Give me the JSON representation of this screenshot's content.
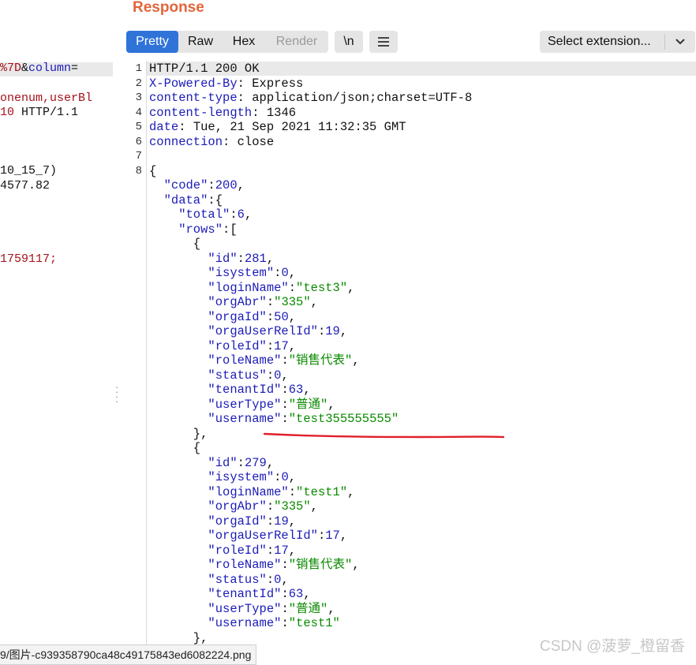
{
  "left_pane": {
    "lines": [
      {
        "parts": [
          {
            "t": "%7D",
            "c": "red"
          },
          {
            "t": "&",
            "c": "plain"
          },
          {
            "t": "column",
            "c": "key"
          },
          {
            "t": "=",
            "c": "plain"
          }
        ]
      },
      {
        "parts": [
          {
            "t": "onenum,userBl",
            "c": "red"
          }
        ]
      },
      {
        "parts": [
          {
            "t": "10",
            "c": "red"
          },
          {
            "t": " HTTP/1.1",
            "c": "plain"
          }
        ]
      },
      {
        "parts": [
          {
            "t": "10_15_7)",
            "c": "plain"
          }
        ]
      },
      {
        "parts": [
          {
            "t": "4577.82",
            "c": "plain"
          }
        ]
      },
      {
        "parts": [
          {
            "t": "1759117;",
            "c": "red"
          }
        ]
      }
    ]
  },
  "response": {
    "title": "Response",
    "tabs": [
      {
        "label": "Pretty",
        "state": "active"
      },
      {
        "label": "Raw",
        "state": "normal"
      },
      {
        "label": "Hex",
        "state": "normal"
      },
      {
        "label": "Render",
        "state": "disabled"
      }
    ],
    "newline_button": "\\n",
    "menu_icon": "hamburger-menu-icon",
    "extension_select": "Select extension...",
    "line_numbers": [
      "1",
      "2",
      "3",
      "4",
      "5",
      "6",
      "7",
      "8"
    ],
    "lines": [
      {
        "parts": [
          {
            "t": "HTTP/1.1 200 OK",
            "c": "p"
          }
        ]
      },
      {
        "parts": [
          {
            "t": "X-Powered-By",
            "c": "k"
          },
          {
            "t": ": Express",
            "c": "p"
          }
        ]
      },
      {
        "parts": [
          {
            "t": "content-type",
            "c": "k"
          },
          {
            "t": ": application/json;charset=UTF-8",
            "c": "p"
          }
        ]
      },
      {
        "parts": [
          {
            "t": "content-length",
            "c": "k"
          },
          {
            "t": ": 1346",
            "c": "p"
          }
        ]
      },
      {
        "parts": [
          {
            "t": "date",
            "c": "k"
          },
          {
            "t": ": Tue, 21 Sep 2021 11:32:35 GMT",
            "c": "p"
          }
        ]
      },
      {
        "parts": [
          {
            "t": "connection",
            "c": "k"
          },
          {
            "t": ": close",
            "c": "p"
          }
        ]
      },
      {
        "parts": []
      },
      {
        "parts": [
          {
            "t": "{",
            "c": "p"
          }
        ]
      },
      {
        "parts": [
          {
            "t": "  \"code\"",
            "c": "k"
          },
          {
            "t": ":",
            "c": "p"
          },
          {
            "t": "200",
            "c": "n"
          },
          {
            "t": ",",
            "c": "p"
          }
        ]
      },
      {
        "parts": [
          {
            "t": "  \"data\"",
            "c": "k"
          },
          {
            "t": ":{",
            "c": "p"
          }
        ]
      },
      {
        "parts": [
          {
            "t": "    \"total\"",
            "c": "k"
          },
          {
            "t": ":",
            "c": "p"
          },
          {
            "t": "6",
            "c": "n"
          },
          {
            "t": ",",
            "c": "p"
          }
        ]
      },
      {
        "parts": [
          {
            "t": "    \"rows\"",
            "c": "k"
          },
          {
            "t": ":[",
            "c": "p"
          }
        ]
      },
      {
        "parts": [
          {
            "t": "      {",
            "c": "p"
          }
        ]
      },
      {
        "parts": [
          {
            "t": "        \"id\"",
            "c": "k"
          },
          {
            "t": ":",
            "c": "p"
          },
          {
            "t": "281",
            "c": "n"
          },
          {
            "t": ",",
            "c": "p"
          }
        ]
      },
      {
        "parts": [
          {
            "t": "        \"isystem\"",
            "c": "k"
          },
          {
            "t": ":",
            "c": "p"
          },
          {
            "t": "0",
            "c": "n"
          },
          {
            "t": ",",
            "c": "p"
          }
        ]
      },
      {
        "parts": [
          {
            "t": "        \"loginName\"",
            "c": "k"
          },
          {
            "t": ":",
            "c": "p"
          },
          {
            "t": "\"test3\"",
            "c": "s"
          },
          {
            "t": ",",
            "c": "p"
          }
        ]
      },
      {
        "parts": [
          {
            "t": "        \"orgAbr\"",
            "c": "k"
          },
          {
            "t": ":",
            "c": "p"
          },
          {
            "t": "\"335\"",
            "c": "s"
          },
          {
            "t": ",",
            "c": "p"
          }
        ]
      },
      {
        "parts": [
          {
            "t": "        \"orgaId\"",
            "c": "k"
          },
          {
            "t": ":",
            "c": "p"
          },
          {
            "t": "50",
            "c": "n"
          },
          {
            "t": ",",
            "c": "p"
          }
        ]
      },
      {
        "parts": [
          {
            "t": "        \"orgaUserRelId\"",
            "c": "k"
          },
          {
            "t": ":",
            "c": "p"
          },
          {
            "t": "19",
            "c": "n"
          },
          {
            "t": ",",
            "c": "p"
          }
        ]
      },
      {
        "parts": [
          {
            "t": "        \"roleId\"",
            "c": "k"
          },
          {
            "t": ":",
            "c": "p"
          },
          {
            "t": "17",
            "c": "n"
          },
          {
            "t": ",",
            "c": "p"
          }
        ]
      },
      {
        "parts": [
          {
            "t": "        \"roleName\"",
            "c": "k"
          },
          {
            "t": ":",
            "c": "p"
          },
          {
            "t": "\"销售代表\"",
            "c": "s"
          },
          {
            "t": ",",
            "c": "p"
          }
        ]
      },
      {
        "parts": [
          {
            "t": "        \"status\"",
            "c": "k"
          },
          {
            "t": ":",
            "c": "p"
          },
          {
            "t": "0",
            "c": "n"
          },
          {
            "t": ",",
            "c": "p"
          }
        ]
      },
      {
        "parts": [
          {
            "t": "        \"tenantId\"",
            "c": "k"
          },
          {
            "t": ":",
            "c": "p"
          },
          {
            "t": "63",
            "c": "n"
          },
          {
            "t": ",",
            "c": "p"
          }
        ]
      },
      {
        "parts": [
          {
            "t": "        \"userType\"",
            "c": "k"
          },
          {
            "t": ":",
            "c": "p"
          },
          {
            "t": "\"普通\"",
            "c": "s"
          },
          {
            "t": ",",
            "c": "p"
          }
        ]
      },
      {
        "parts": [
          {
            "t": "        \"username\"",
            "c": "k"
          },
          {
            "t": ":",
            "c": "p"
          },
          {
            "t": "\"test355555555\"",
            "c": "s"
          }
        ]
      },
      {
        "parts": [
          {
            "t": "      },",
            "c": "p"
          }
        ]
      },
      {
        "parts": [
          {
            "t": "      {",
            "c": "p"
          }
        ]
      },
      {
        "parts": [
          {
            "t": "        \"id\"",
            "c": "k"
          },
          {
            "t": ":",
            "c": "p"
          },
          {
            "t": "279",
            "c": "n"
          },
          {
            "t": ",",
            "c": "p"
          }
        ]
      },
      {
        "parts": [
          {
            "t": "        \"isystem\"",
            "c": "k"
          },
          {
            "t": ":",
            "c": "p"
          },
          {
            "t": "0",
            "c": "n"
          },
          {
            "t": ",",
            "c": "p"
          }
        ]
      },
      {
        "parts": [
          {
            "t": "        \"loginName\"",
            "c": "k"
          },
          {
            "t": ":",
            "c": "p"
          },
          {
            "t": "\"test1\"",
            "c": "s"
          },
          {
            "t": ",",
            "c": "p"
          }
        ]
      },
      {
        "parts": [
          {
            "t": "        \"orgAbr\"",
            "c": "k"
          },
          {
            "t": ":",
            "c": "p"
          },
          {
            "t": "\"335\"",
            "c": "s"
          },
          {
            "t": ",",
            "c": "p"
          }
        ]
      },
      {
        "parts": [
          {
            "t": "        \"orgaId\"",
            "c": "k"
          },
          {
            "t": ":",
            "c": "p"
          },
          {
            "t": "19",
            "c": "n"
          },
          {
            "t": ",",
            "c": "p"
          }
        ]
      },
      {
        "parts": [
          {
            "t": "        \"orgaUserRelId\"",
            "c": "k"
          },
          {
            "t": ":",
            "c": "p"
          },
          {
            "t": "17",
            "c": "n"
          },
          {
            "t": ",",
            "c": "p"
          }
        ]
      },
      {
        "parts": [
          {
            "t": "        \"roleId\"",
            "c": "k"
          },
          {
            "t": ":",
            "c": "p"
          },
          {
            "t": "17",
            "c": "n"
          },
          {
            "t": ",",
            "c": "p"
          }
        ]
      },
      {
        "parts": [
          {
            "t": "        \"roleName\"",
            "c": "k"
          },
          {
            "t": ":",
            "c": "p"
          },
          {
            "t": "\"销售代表\"",
            "c": "s"
          },
          {
            "t": ",",
            "c": "p"
          }
        ]
      },
      {
        "parts": [
          {
            "t": "        \"status\"",
            "c": "k"
          },
          {
            "t": ":",
            "c": "p"
          },
          {
            "t": "0",
            "c": "n"
          },
          {
            "t": ",",
            "c": "p"
          }
        ]
      },
      {
        "parts": [
          {
            "t": "        \"tenantId\"",
            "c": "k"
          },
          {
            "t": ":",
            "c": "p"
          },
          {
            "t": "63",
            "c": "n"
          },
          {
            "t": ",",
            "c": "p"
          }
        ]
      },
      {
        "parts": [
          {
            "t": "        \"userType\"",
            "c": "k"
          },
          {
            "t": ":",
            "c": "p"
          },
          {
            "t": "\"普通\"",
            "c": "s"
          },
          {
            "t": ",",
            "c": "p"
          }
        ]
      },
      {
        "parts": [
          {
            "t": "        \"username\"",
            "c": "k"
          },
          {
            "t": ":",
            "c": "p"
          },
          {
            "t": "\"test1\"",
            "c": "s"
          }
        ]
      },
      {
        "parts": [
          {
            "t": "      },",
            "c": "p"
          }
        ]
      }
    ]
  },
  "status_bar": {
    "path": "9/图片-c939358790ca48c49175843ed6082224.png"
  },
  "watermark": "CSDN @菠萝_橙留香",
  "colors": {
    "accent": "#2f73d9",
    "title": "#e3653b",
    "key": "#1c1cb8",
    "string": "#0a8a00",
    "annotation": "#e0202a"
  }
}
